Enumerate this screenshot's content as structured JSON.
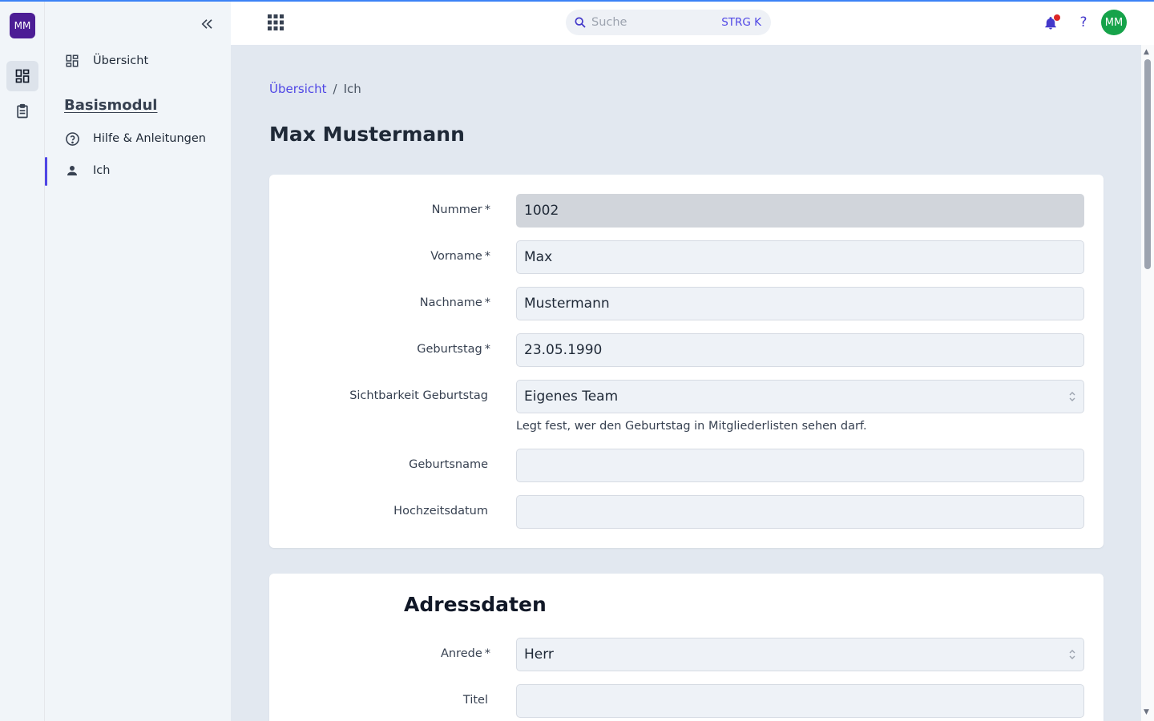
{
  "rail": {
    "logo_initials": "MM",
    "items": [
      {
        "icon": "dashboard-icon",
        "active": true
      },
      {
        "icon": "clipboard-icon",
        "active": false
      }
    ]
  },
  "sidebar": {
    "collapse_icon": "double-chevron-left-icon",
    "overview_label": "Übersicht",
    "section_heading": "Basismodul",
    "items": [
      {
        "label": "Hilfe & Anleitungen",
        "icon": "help-circle-icon"
      },
      {
        "label": "Ich",
        "icon": "person-icon",
        "active": true
      }
    ]
  },
  "header": {
    "search_placeholder": "Suche",
    "search_shortcut": "STRG K",
    "help_label": "?",
    "avatar_initials": "MM"
  },
  "breadcrumb": {
    "home": "Übersicht",
    "separator": "/",
    "current": "Ich"
  },
  "page_title": "Max Mustermann",
  "personal": {
    "fields": [
      {
        "label": "Nummer",
        "required": "*",
        "value": "1002",
        "disabled": true
      },
      {
        "label": "Vorname",
        "required": "*",
        "value": "Max"
      },
      {
        "label": "Nachname",
        "required": "*",
        "value": "Mustermann"
      },
      {
        "label": "Geburtstag",
        "required": "*",
        "value": "23.05.1990"
      },
      {
        "label": "Sichtbarkeit Geburtstag",
        "required": "",
        "value": "Eigenes Team",
        "type": "select"
      },
      {
        "label": "Geburtsname",
        "required": "",
        "value": ""
      },
      {
        "label": "Hochzeitsdatum",
        "required": "",
        "value": ""
      }
    ],
    "visibility_hint": "Legt fest, wer den Geburtstag in Mitgliederlisten sehen darf."
  },
  "address": {
    "title": "Adressdaten",
    "fields": [
      {
        "label": "Anrede",
        "required": "*",
        "value": "Herr",
        "type": "select"
      },
      {
        "label": "Titel",
        "required": "",
        "value": ""
      }
    ]
  },
  "colors": {
    "accent": "#4f46e5",
    "logo_bg": "#4c1d95",
    "avatar_bg": "#16a34a",
    "notification_dot": "#dc2626"
  }
}
